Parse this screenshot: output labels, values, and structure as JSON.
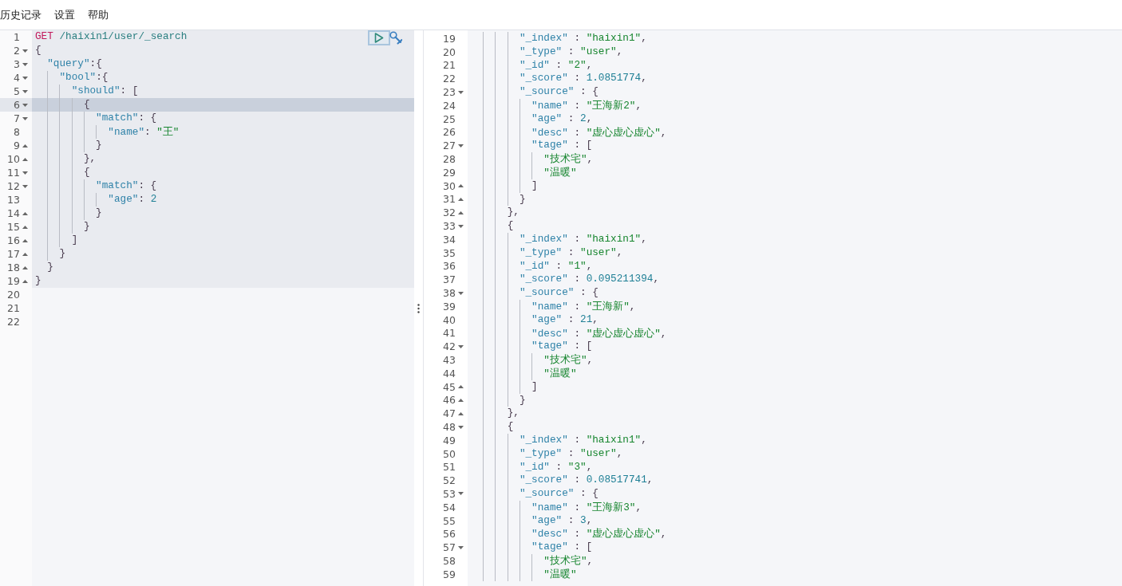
{
  "menu": [
    {
      "label": "历史记录"
    },
    {
      "label": "设置"
    },
    {
      "label": "帮助"
    }
  ],
  "request_editor": {
    "lines": [
      {
        "number": "1",
        "kind": "plain",
        "active": false,
        "in_block": true,
        "tokens": [
          {
            "text": "GET",
            "kind": "method"
          },
          {
            "text": " /haixin1/user/_search",
            "kind": "url"
          }
        ]
      },
      {
        "number": "2",
        "kind": "open",
        "active": false,
        "in_block": true,
        "tokens": [
          {
            "text": "{",
            "kind": "punct"
          }
        ],
        "children": [
          {
            "number": "3",
            "kind": "open",
            "active": false,
            "in_block": true,
            "tokens": [
              {
                "text": "\"query\"",
                "kind": "key"
              },
              {
                "text": ":{",
                "kind": "punct"
              }
            ],
            "children": [
              {
                "number": "4",
                "kind": "open",
                "active": false,
                "in_block": true,
                "tokens": [
                  {
                    "text": "\"bool\"",
                    "kind": "key"
                  },
                  {
                    "text": ":{",
                    "kind": "punct"
                  }
                ],
                "children": [
                  {
                    "number": "5",
                    "kind": "open",
                    "active": false,
                    "in_block": true,
                    "tokens": [
                      {
                        "text": "\"should\"",
                        "kind": "key"
                      },
                      {
                        "text": ": [",
                        "kind": "punct"
                      }
                    ],
                    "children": [
                      {
                        "number": "6",
                        "kind": "open",
                        "active": true,
                        "in_block": true,
                        "tokens": [
                          {
                            "text": "{",
                            "kind": "punct"
                          }
                        ],
                        "children": [
                          {
                            "number": "7",
                            "kind": "open",
                            "active": false,
                            "in_block": true,
                            "tokens": [
                              {
                                "text": "\"match\"",
                                "kind": "key"
                              },
                              {
                                "text": ": {",
                                "kind": "punct"
                              }
                            ],
                            "children": [
                              {
                                "number": "8",
                                "kind": "plain",
                                "active": false,
                                "in_block": true,
                                "tokens": [
                                  {
                                    "text": "\"name\"",
                                    "kind": "key"
                                  },
                                  {
                                    "text": ": ",
                                    "kind": "punct"
                                  },
                                  {
                                    "text": "\"王\"",
                                    "kind": "string"
                                  }
                                ]
                              }
                            ]
                          },
                          {
                            "number": "9",
                            "kind": "close",
                            "active": false,
                            "in_block": true,
                            "tokens": [
                              {
                                "text": "}",
                                "kind": "punct"
                              }
                            ]
                          }
                        ]
                      },
                      {
                        "number": "10",
                        "kind": "close",
                        "active": false,
                        "in_block": true,
                        "tokens": [
                          {
                            "text": "},",
                            "kind": "punct"
                          }
                        ]
                      },
                      {
                        "number": "11",
                        "kind": "open",
                        "active": false,
                        "in_block": true,
                        "tokens": [
                          {
                            "text": "{",
                            "kind": "punct"
                          }
                        ],
                        "children": [
                          {
                            "number": "12",
                            "kind": "open",
                            "active": false,
                            "in_block": true,
                            "tokens": [
                              {
                                "text": "\"match\"",
                                "kind": "key"
                              },
                              {
                                "text": ": {",
                                "kind": "punct"
                              }
                            ],
                            "children": [
                              {
                                "number": "13",
                                "kind": "plain",
                                "active": false,
                                "in_block": true,
                                "tokens": [
                                  {
                                    "text": "\"age\"",
                                    "kind": "key"
                                  },
                                  {
                                    "text": ": ",
                                    "kind": "punct"
                                  },
                                  {
                                    "text": "2",
                                    "kind": "number"
                                  }
                                ]
                              }
                            ]
                          },
                          {
                            "number": "14",
                            "kind": "close",
                            "active": false,
                            "in_block": true,
                            "tokens": [
                              {
                                "text": "}",
                                "kind": "punct"
                              }
                            ]
                          }
                        ]
                      },
                      {
                        "number": "15",
                        "kind": "close",
                        "active": false,
                        "in_block": true,
                        "tokens": [
                          {
                            "text": "}",
                            "kind": "punct"
                          }
                        ]
                      }
                    ]
                  },
                  {
                    "number": "16",
                    "kind": "close",
                    "active": false,
                    "in_block": true,
                    "tokens": [
                      {
                        "text": "]",
                        "kind": "punct"
                      }
                    ]
                  }
                ]
              },
              {
                "number": "17",
                "kind": "close",
                "active": false,
                "in_block": true,
                "tokens": [
                  {
                    "text": "}",
                    "kind": "punct"
                  }
                ]
              }
            ]
          },
          {
            "number": "18",
            "kind": "close",
            "active": false,
            "in_block": true,
            "tokens": [
              {
                "text": "}",
                "kind": "punct"
              }
            ]
          }
        ]
      },
      {
        "number": "19",
        "kind": "close",
        "active": false,
        "in_block": true,
        "tokens": [
          {
            "text": "}",
            "kind": "punct"
          }
        ]
      },
      {
        "number": "20",
        "kind": "plain",
        "active": false,
        "in_block": false
      },
      {
        "number": "21",
        "kind": "plain",
        "active": false,
        "in_block": false
      },
      {
        "number": "22",
        "kind": "plain",
        "active": false,
        "in_block": false
      }
    ]
  },
  "response_viewer": {
    "lines": [
      {
        "children": [
          {
            "number": "19",
            "kind": "plain",
            "tokens": [
              {
                "text": "\"_index\"",
                "kind": "key"
              },
              {
                "text": " : ",
                "kind": "punct"
              },
              {
                "text": "\"haixin1\"",
                "kind": "string"
              },
              {
                "text": ",",
                "kind": "punct"
              }
            ]
          },
          {
            "number": "20",
            "kind": "plain",
            "tokens": [
              {
                "text": "\"_type\"",
                "kind": "key"
              },
              {
                "text": " : ",
                "kind": "punct"
              },
              {
                "text": "\"user\"",
                "kind": "string"
              },
              {
                "text": ",",
                "kind": "punct"
              }
            ]
          },
          {
            "number": "21",
            "kind": "plain",
            "tokens": [
              {
                "text": "\"_id\"",
                "kind": "key"
              },
              {
                "text": " : ",
                "kind": "punct"
              },
              {
                "text": "\"2\"",
                "kind": "string"
              },
              {
                "text": ",",
                "kind": "punct"
              }
            ]
          },
          {
            "number": "22",
            "kind": "plain",
            "tokens": [
              {
                "text": "\"_score\"",
                "kind": "key"
              },
              {
                "text": " : ",
                "kind": "punct"
              },
              {
                "text": "1.0851774",
                "kind": "number"
              },
              {
                "text": ",",
                "kind": "punct"
              }
            ]
          },
          {
            "number": "23",
            "kind": "open",
            "tokens": [
              {
                "text": "\"_source\"",
                "kind": "key"
              },
              {
                "text": " : {",
                "kind": "punct"
              }
            ],
            "children": [
              {
                "number": "24",
                "kind": "plain",
                "tokens": [
                  {
                    "text": "\"name\"",
                    "kind": "key"
                  },
                  {
                    "text": " : ",
                    "kind": "punct"
                  },
                  {
                    "text": "\"王海新2\"",
                    "kind": "string"
                  },
                  {
                    "text": ",",
                    "kind": "punct"
                  }
                ]
              },
              {
                "number": "25",
                "kind": "plain",
                "tokens": [
                  {
                    "text": "\"age\"",
                    "kind": "key"
                  },
                  {
                    "text": " : ",
                    "kind": "punct"
                  },
                  {
                    "text": "2",
                    "kind": "number"
                  },
                  {
                    "text": ",",
                    "kind": "punct"
                  }
                ]
              },
              {
                "number": "26",
                "kind": "plain",
                "tokens": [
                  {
                    "text": "\"desc\"",
                    "kind": "key"
                  },
                  {
                    "text": " : ",
                    "kind": "punct"
                  },
                  {
                    "text": "\"虚心虚心虚心\"",
                    "kind": "string"
                  },
                  {
                    "text": ",",
                    "kind": "punct"
                  }
                ]
              },
              {
                "number": "27",
                "kind": "open",
                "tokens": [
                  {
                    "text": "\"tage\"",
                    "kind": "key"
                  },
                  {
                    "text": " : [",
                    "kind": "punct"
                  }
                ],
                "children": [
                  {
                    "number": "28",
                    "kind": "plain",
                    "tokens": [
                      {
                        "text": "\"技术宅\"",
                        "kind": "string"
                      },
                      {
                        "text": ",",
                        "kind": "punct"
                      }
                    ]
                  },
                  {
                    "number": "29",
                    "kind": "plain",
                    "tokens": [
                      {
                        "text": "\"温暖\"",
                        "kind": "string"
                      }
                    ]
                  }
                ]
              },
              {
                "number": "30",
                "kind": "close",
                "tokens": [
                  {
                    "text": "]",
                    "kind": "punct"
                  }
                ]
              }
            ]
          },
          {
            "number": "31",
            "kind": "close",
            "tokens": [
              {
                "text": "}",
                "kind": "punct"
              }
            ]
          }
        ]
      },
      {
        "number": "32",
        "kind": "close",
        "tokens": [
          {
            "text": "},",
            "kind": "punct"
          }
        ]
      },
      {
        "number": "33",
        "kind": "open",
        "tokens": [
          {
            "text": "{",
            "kind": "punct"
          }
        ],
        "children": [
          {
            "number": "34",
            "kind": "plain",
            "tokens": [
              {
                "text": "\"_index\"",
                "kind": "key"
              },
              {
                "text": " : ",
                "kind": "punct"
              },
              {
                "text": "\"haixin1\"",
                "kind": "string"
              },
              {
                "text": ",",
                "kind": "punct"
              }
            ]
          },
          {
            "number": "35",
            "kind": "plain",
            "tokens": [
              {
                "text": "\"_type\"",
                "kind": "key"
              },
              {
                "text": " : ",
                "kind": "punct"
              },
              {
                "text": "\"user\"",
                "kind": "string"
              },
              {
                "text": ",",
                "kind": "punct"
              }
            ]
          },
          {
            "number": "36",
            "kind": "plain",
            "tokens": [
              {
                "text": "\"_id\"",
                "kind": "key"
              },
              {
                "text": " : ",
                "kind": "punct"
              },
              {
                "text": "\"1\"",
                "kind": "string"
              },
              {
                "text": ",",
                "kind": "punct"
              }
            ]
          },
          {
            "number": "37",
            "kind": "plain",
            "tokens": [
              {
                "text": "\"_score\"",
                "kind": "key"
              },
              {
                "text": " : ",
                "kind": "punct"
              },
              {
                "text": "0.095211394",
                "kind": "number"
              },
              {
                "text": ",",
                "kind": "punct"
              }
            ]
          },
          {
            "number": "38",
            "kind": "open",
            "tokens": [
              {
                "text": "\"_source\"",
                "kind": "key"
              },
              {
                "text": " : {",
                "kind": "punct"
              }
            ],
            "children": [
              {
                "number": "39",
                "kind": "plain",
                "tokens": [
                  {
                    "text": "\"name\"",
                    "kind": "key"
                  },
                  {
                    "text": " : ",
                    "kind": "punct"
                  },
                  {
                    "text": "\"王海新\"",
                    "kind": "string"
                  },
                  {
                    "text": ",",
                    "kind": "punct"
                  }
                ]
              },
              {
                "number": "40",
                "kind": "plain",
                "tokens": [
                  {
                    "text": "\"age\"",
                    "kind": "key"
                  },
                  {
                    "text": " : ",
                    "kind": "punct"
                  },
                  {
                    "text": "21",
                    "kind": "number"
                  },
                  {
                    "text": ",",
                    "kind": "punct"
                  }
                ]
              },
              {
                "number": "41",
                "kind": "plain",
                "tokens": [
                  {
                    "text": "\"desc\"",
                    "kind": "key"
                  },
                  {
                    "text": " : ",
                    "kind": "punct"
                  },
                  {
                    "text": "\"虚心虚心虚心\"",
                    "kind": "string"
                  },
                  {
                    "text": ",",
                    "kind": "punct"
                  }
                ]
              },
              {
                "number": "42",
                "kind": "open",
                "tokens": [
                  {
                    "text": "\"tage\"",
                    "kind": "key"
                  },
                  {
                    "text": " : [",
                    "kind": "punct"
                  }
                ],
                "children": [
                  {
                    "number": "43",
                    "kind": "plain",
                    "tokens": [
                      {
                        "text": "\"技术宅\"",
                        "kind": "string"
                      },
                      {
                        "text": ",",
                        "kind": "punct"
                      }
                    ]
                  },
                  {
                    "number": "44",
                    "kind": "plain",
                    "tokens": [
                      {
                        "text": "\"温暖\"",
                        "kind": "string"
                      }
                    ]
                  }
                ]
              },
              {
                "number": "45",
                "kind": "close",
                "tokens": [
                  {
                    "text": "]",
                    "kind": "punct"
                  }
                ]
              }
            ]
          },
          {
            "number": "46",
            "kind": "close",
            "tokens": [
              {
                "text": "}",
                "kind": "punct"
              }
            ]
          }
        ]
      },
      {
        "number": "47",
        "kind": "close",
        "tokens": [
          {
            "text": "},",
            "kind": "punct"
          }
        ]
      },
      {
        "number": "48",
        "kind": "open",
        "tokens": [
          {
            "text": "{",
            "kind": "punct"
          }
        ],
        "children": [
          {
            "number": "49",
            "kind": "plain",
            "tokens": [
              {
                "text": "\"_index\"",
                "kind": "key"
              },
              {
                "text": " : ",
                "kind": "punct"
              },
              {
                "text": "\"haixin1\"",
                "kind": "string"
              },
              {
                "text": ",",
                "kind": "punct"
              }
            ]
          },
          {
            "number": "50",
            "kind": "plain",
            "tokens": [
              {
                "text": "\"_type\"",
                "kind": "key"
              },
              {
                "text": " : ",
                "kind": "punct"
              },
              {
                "text": "\"user\"",
                "kind": "string"
              },
              {
                "text": ",",
                "kind": "punct"
              }
            ]
          },
          {
            "number": "51",
            "kind": "plain",
            "tokens": [
              {
                "text": "\"_id\"",
                "kind": "key"
              },
              {
                "text": " : ",
                "kind": "punct"
              },
              {
                "text": "\"3\"",
                "kind": "string"
              },
              {
                "text": ",",
                "kind": "punct"
              }
            ]
          },
          {
            "number": "52",
            "kind": "plain",
            "tokens": [
              {
                "text": "\"_score\"",
                "kind": "key"
              },
              {
                "text": " : ",
                "kind": "punct"
              },
              {
                "text": "0.08517741",
                "kind": "number"
              },
              {
                "text": ",",
                "kind": "punct"
              }
            ]
          },
          {
            "number": "53",
            "kind": "open",
            "tokens": [
              {
                "text": "\"_source\"",
                "kind": "key"
              },
              {
                "text": " : {",
                "kind": "punct"
              }
            ],
            "children": [
              {
                "number": "54",
                "kind": "plain",
                "tokens": [
                  {
                    "text": "\"name\"",
                    "kind": "key"
                  },
                  {
                    "text": " : ",
                    "kind": "punct"
                  },
                  {
                    "text": "\"王海新3\"",
                    "kind": "string"
                  },
                  {
                    "text": ",",
                    "kind": "punct"
                  }
                ]
              },
              {
                "number": "55",
                "kind": "plain",
                "tokens": [
                  {
                    "text": "\"age\"",
                    "kind": "key"
                  },
                  {
                    "text": " : ",
                    "kind": "punct"
                  },
                  {
                    "text": "3",
                    "kind": "number"
                  },
                  {
                    "text": ",",
                    "kind": "punct"
                  }
                ]
              },
              {
                "number": "56",
                "kind": "plain",
                "tokens": [
                  {
                    "text": "\"desc\"",
                    "kind": "key"
                  },
                  {
                    "text": " : ",
                    "kind": "punct"
                  },
                  {
                    "text": "\"虚心虚心虚心\"",
                    "kind": "string"
                  },
                  {
                    "text": ",",
                    "kind": "punct"
                  }
                ]
              },
              {
                "number": "57",
                "kind": "open",
                "tokens": [
                  {
                    "text": "\"tage\"",
                    "kind": "key"
                  },
                  {
                    "text": " : [",
                    "kind": "punct"
                  }
                ],
                "children": [
                  {
                    "number": "58",
                    "kind": "plain",
                    "tokens": [
                      {
                        "text": "\"技术宅\"",
                        "kind": "string"
                      },
                      {
                        "text": ",",
                        "kind": "punct"
                      }
                    ]
                  },
                  {
                    "number": "59",
                    "kind": "plain",
                    "tokens": [
                      {
                        "text": "\"温暖\"",
                        "kind": "string"
                      }
                    ]
                  }
                ]
              }
            ]
          }
        ]
      }
    ]
  }
}
